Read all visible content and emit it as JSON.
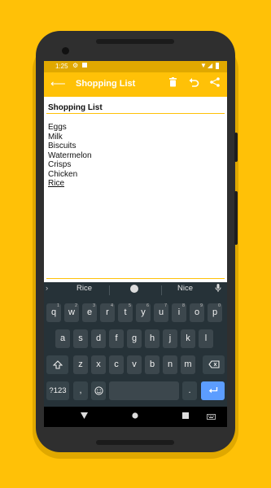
{
  "status_bar": {
    "time": "1:25"
  },
  "app_bar": {
    "title": "Shopping List",
    "back_icon": "arrow-back-icon",
    "actions": [
      "delete-icon",
      "undo-icon",
      "share-icon"
    ]
  },
  "note": {
    "title": "Shopping List",
    "items": [
      "Eggs",
      "Milk",
      "Biscuits",
      "Watermelon",
      "Crisps",
      "Chicken",
      "Rice"
    ]
  },
  "suggestions": [
    "Rice",
    "Nice"
  ],
  "keyboard": {
    "row1": [
      "q",
      "w",
      "e",
      "r",
      "t",
      "y",
      "u",
      "i",
      "o",
      "p"
    ],
    "row1_hints": [
      "1",
      "2",
      "3",
      "4",
      "5",
      "6",
      "7",
      "8",
      "9",
      "0"
    ],
    "row2": [
      "a",
      "s",
      "d",
      "f",
      "g",
      "h",
      "j",
      "k",
      "l"
    ],
    "row3": [
      "z",
      "x",
      "c",
      "v",
      "b",
      "n",
      "m"
    ],
    "symbols_label": "?123",
    "comma": ",",
    "period": "."
  },
  "colors": {
    "accent": "#FFC107",
    "keyboard_bg": "#263238",
    "enter_key": "#5C9DFF"
  }
}
